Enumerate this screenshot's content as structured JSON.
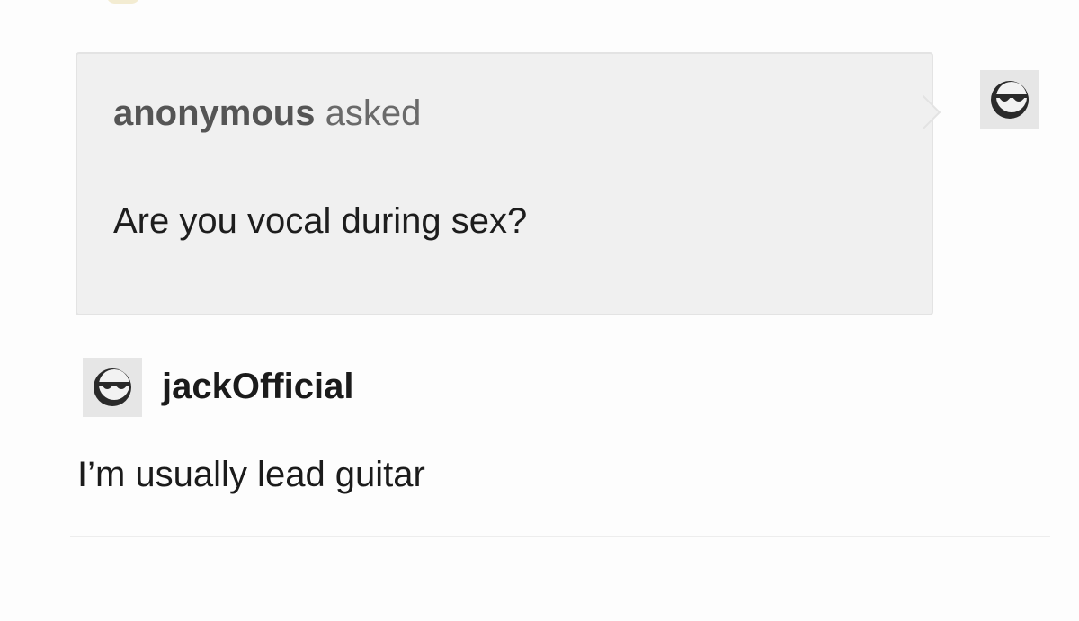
{
  "ask": {
    "asker": "anonymous",
    "verb": "asked",
    "question": "Are you vocal during sex?"
  },
  "answer": {
    "username": "jackOfficial",
    "text": "I’m usually lead guitar"
  },
  "icons": {
    "avatar": "sunglasses-avatar-icon"
  },
  "colors": {
    "ask_background": "#f0f0f0",
    "page_background": "#fdfdfd",
    "avatar_background": "#e6e6e6"
  }
}
